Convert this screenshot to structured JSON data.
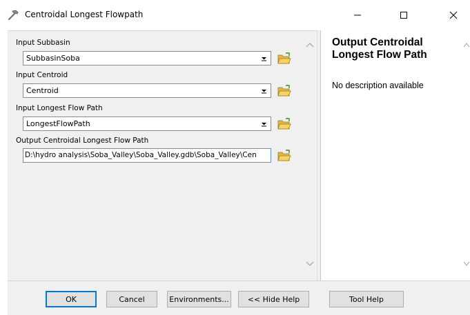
{
  "window": {
    "title": "Centroidal Longest Flowpath",
    "minimize_glyph": "—",
    "maximize_glyph": "☐",
    "close_glyph": "✕"
  },
  "form": {
    "input_subbasin": {
      "label": "Input Subbasin",
      "value": "SubbasinSoba"
    },
    "input_centroid": {
      "label": "Input Centroid",
      "value": "Centroid"
    },
    "input_longest_flow_path": {
      "label": "Input Longest Flow Path",
      "value": "LongestFlowPath"
    },
    "output_path": {
      "label": "Output Centroidal Longest Flow Path",
      "value": "D:\\hydro analysis\\Soba_Valley\\Soba_Valley.gdb\\Soba_Valley\\Cen"
    }
  },
  "help": {
    "title": "Output Centroidal Longest Flow Path",
    "description": "No description available"
  },
  "buttons": {
    "ok": "OK",
    "cancel": "Cancel",
    "environments": "Environments...",
    "hide_help": "<< Hide Help",
    "tool_help": "Tool Help"
  },
  "icons": {
    "title": "hammer-icon",
    "folder": "folder-open-icon",
    "dropdown": "chevron-down-icon"
  },
  "colors": {
    "focus_border": "#0078d7",
    "folder_yellow": "#e8b63a",
    "panel_bg": "#f0f0f0"
  }
}
